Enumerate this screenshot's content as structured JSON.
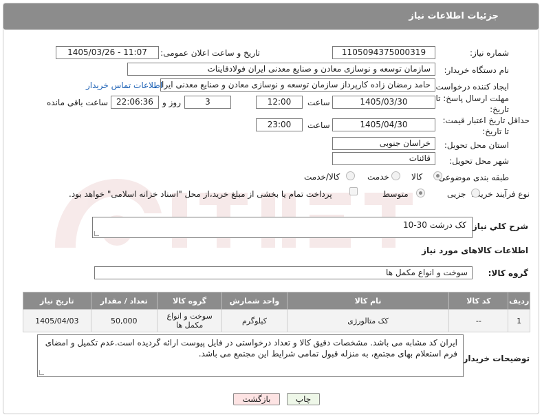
{
  "header": {
    "title": "جزئیات اطلاعات نیاز"
  },
  "fields": {
    "need_number_label": "شماره نیاز:",
    "need_number": "1105094375000319",
    "announce_label": "تاریخ و ساعت اعلان عمومی:",
    "announce_value": "1405/03/26 - 11:07",
    "buyer_org_label": "نام دستگاه خریدار:",
    "buyer_org": "سازمان توسعه و نوسازی معادن و صنایع معدنی ایران فولادقاینات",
    "requester_label": "ایجاد کننده درخواست:",
    "requester": "حامد  رمضان زاده  کارپرداز  سازمان توسعه و نوسازی معادن و صنایع معدنی ایران",
    "contact_link": "اطلاعات تماس خریدار",
    "deadline_label_1": "مهلت ارسال پاسخ: تا",
    "deadline_label_2": "تاریخ:",
    "deadline_date": "1405/03/30",
    "time_label": "ساعت",
    "deadline_time": "12:00",
    "days_value": "3",
    "days_label": "روز و",
    "remaining_time": "22:06:36",
    "remaining_label": "ساعت باقی مانده",
    "price_label_1": "حداقل تاریخ اعتبار قیمت:",
    "price_label_2": "تا تاریخ:",
    "price_date": "1405/04/30",
    "price_time_label": "ساعت",
    "price_time": "23:00",
    "province_label": "استان محل تحویل:",
    "province": "خراسان جنوبی",
    "city_label": "شهر محل تحویل:",
    "city": "قائنات",
    "category_label": "طبقه بندی موضوعی:",
    "category_options": [
      "کالا",
      "خدمت",
      "کالا/خدمت"
    ],
    "process_label": "نوع فرآیند خرید :",
    "process_options": [
      "جزیی",
      "متوسط"
    ],
    "payment_note": "پرداخت تمام یا بخشی از مبلغ خرید،از محل \"اسناد خزانه اسلامی\" خواهد بود."
  },
  "description": {
    "label": "شرح کلي نياز:",
    "value": "کک درشت 30-10"
  },
  "goods": {
    "section_title": "اطلاعات کالاهای مورد نیاز",
    "group_label": "گروه کالا:",
    "group_value": "سوخت و انواع مکمل ها",
    "columns": [
      "ردیف",
      "کد کالا",
      "نام کالا",
      "واحد شمارش",
      "گروه کالا",
      "تعداد / مقدار",
      "تاریخ نیاز"
    ],
    "rows": [
      {
        "row": "1",
        "code": "--",
        "name": "کک متالورژی",
        "unit": "کیلوگرم",
        "group": "سوخت و انواع مکمل ها",
        "qty": "50,000",
        "date": "1405/04/03"
      }
    ]
  },
  "buyer_notes": {
    "label": "توضیحات خریدار:",
    "value": "ایران کد مشابه می باشد. مشخصات دقیق کالا و تعداد درخواستی در فایل پیوست ارائه گردیده است.عدم تکمیل و امضای فرم استعلام بهای مجتمع، به منزله قبول تمامی شرایط این مجتمع می باشد."
  },
  "buttons": {
    "print": "چاپ",
    "back": "بازگشت"
  },
  "colors": {
    "header_bg": "#8c8c8c",
    "link": "#1a5fb4",
    "back_button_bg": "#fde3e3",
    "print_button_bg": "#eef7e8"
  }
}
